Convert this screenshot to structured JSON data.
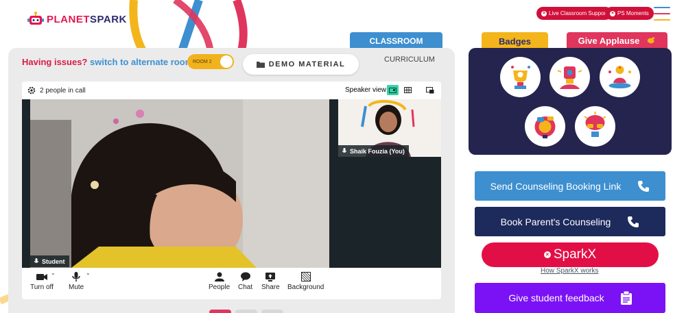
{
  "brand": {
    "logo_text_a": "PLANET",
    "logo_text_b": "SPARK"
  },
  "header": {
    "live_support_label": "Live Classroom Support",
    "ps_moments_label": "PS Moments"
  },
  "tabs": {
    "classroom": "CLASSROOM",
    "badges": "Badges",
    "applause": "Give Applause"
  },
  "room_bar": {
    "issues_text": "Having issues?",
    "switch_text": "switch to alternate room",
    "room_toggle": "ROOM 2",
    "demo_material": "DEMO MATERIAL",
    "curriculum": "CURRICULUM"
  },
  "call": {
    "people_count": "2 people in call",
    "speaker_view": "Speaker view",
    "main_participant": "Student",
    "side_participant": "Shaik Fouzia (You)",
    "controls": {
      "turn_off": "Turn off",
      "mute": "Mute",
      "people": "People",
      "chat": "Chat",
      "share": "Share",
      "background": "Background"
    }
  },
  "actions": {
    "send_counseling": "Send Counseling Booking Link",
    "book_parent": "Book Parent's Counseling",
    "sparkx": "SparkX",
    "how_sparkx": "How SparkX works",
    "give_feedback": "Give student feedback"
  },
  "colors": {
    "brand_red": "#e20f46",
    "classroom_blue": "#3d8fd0",
    "badges_yellow": "#f3b51b",
    "navy": "#25244f",
    "feedback_purple": "#7b12f5",
    "counsel_blue": "#3d8fd0",
    "parent_navy": "#1d2a5c"
  }
}
